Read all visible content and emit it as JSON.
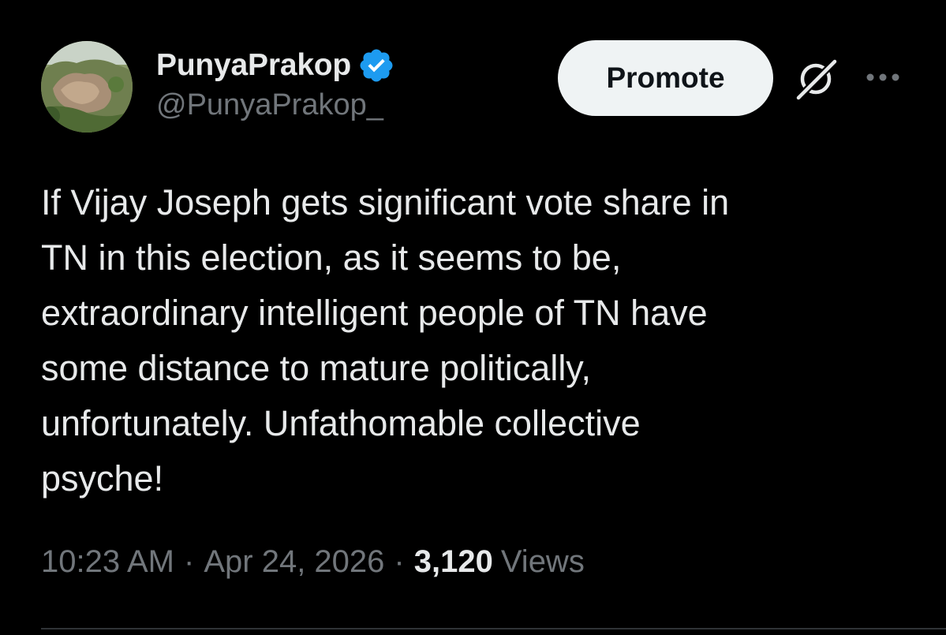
{
  "author": {
    "display_name": "PunyaPrakop",
    "handle": "@PunyaPrakop_",
    "verified": true,
    "verified_color": "#1d9bf0",
    "avatar_icon": "landscape-rock-avatar"
  },
  "header": {
    "promote_label": "Promote",
    "grok_icon": "grok-icon",
    "more_icon": "more-dots-icon"
  },
  "tweet": {
    "lines": [
      "If Vijay Joseph gets significant vote share in",
      "TN in this election, as it seems to be,",
      "extraordinary intelligent people of TN have",
      "some distance to mature politically,",
      "unfortunately. Unfathomable collective",
      "psyche!"
    ]
  },
  "meta": {
    "time": "10:23 AM",
    "separator": "·",
    "date": "Apr 24, 2026",
    "views_count": "3,120",
    "views_label": "Views"
  },
  "colors": {
    "background": "#000000",
    "text_primary": "#e7e9ea",
    "text_secondary": "#71767b",
    "button_bg": "#eff3f4",
    "divider": "#2f3336"
  }
}
